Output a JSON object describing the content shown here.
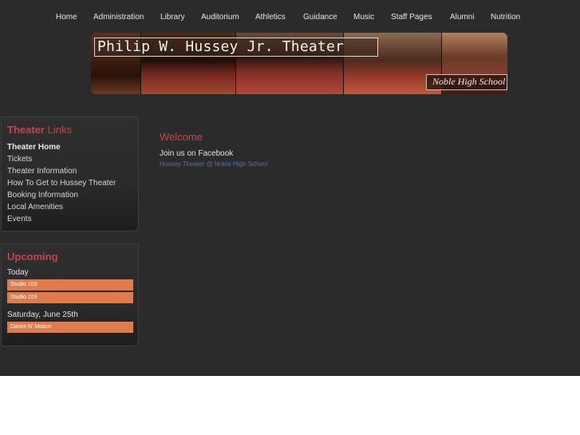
{
  "nav": {
    "items": [
      {
        "label": "Home"
      },
      {
        "label": "Administration"
      },
      {
        "label": "Library"
      },
      {
        "label": "Auditorium"
      },
      {
        "label": "Athletics"
      },
      {
        "label": "Guidance"
      },
      {
        "label": "Music"
      },
      {
        "label": "Staff Pages"
      },
      {
        "label": "Alumni"
      },
      {
        "label": "Nutrition"
      }
    ]
  },
  "banner": {
    "title": "Philip W. Hussey Jr. Theater",
    "subtitle": "Noble High School"
  },
  "sidebar": {
    "links_box": {
      "title_highlight": "Theater",
      "title_rest": "Links",
      "items": [
        {
          "label": "Theater Home",
          "active": true
        },
        {
          "label": "Tickets"
        },
        {
          "label": "Theater Information"
        },
        {
          "label": "How To Get to Hussey Theater"
        },
        {
          "label": "Booking Information"
        },
        {
          "label": "Local Amenities"
        },
        {
          "label": "Events"
        }
      ]
    },
    "upcoming": {
      "title": "Upcoming",
      "days": [
        {
          "label": "Today",
          "events": [
            "Studio 109",
            "Studio 109"
          ]
        },
        {
          "label": "Saturday, June 25th",
          "events": [
            "Dance N' Motion"
          ]
        }
      ]
    }
  },
  "main": {
    "heading": "Welcome",
    "text": "Join us on Facebook",
    "link": "Hussey Theater @ Noble High School"
  },
  "colors": {
    "background": "#2b2b2b",
    "accent": "#c0474f",
    "event_bar": "#e07c4c",
    "link": "#5a6ea8"
  }
}
